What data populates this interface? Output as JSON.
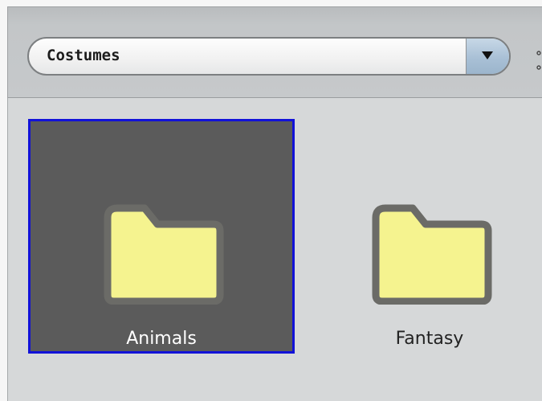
{
  "dropdown": {
    "selected_value": "Costumes"
  },
  "folders": [
    {
      "label": "Animals",
      "selected": true
    },
    {
      "label": "Fantasy",
      "selected": false
    }
  ],
  "colors": {
    "selection_border": "#1212d8",
    "selected_tile_bg": "#5b5b5b",
    "folder_fill": "#f5f38f",
    "folder_outline": "#6b6b67"
  },
  "icons": {
    "dropdown_arrow": "chevron-down-icon",
    "folder": "folder-icon"
  }
}
